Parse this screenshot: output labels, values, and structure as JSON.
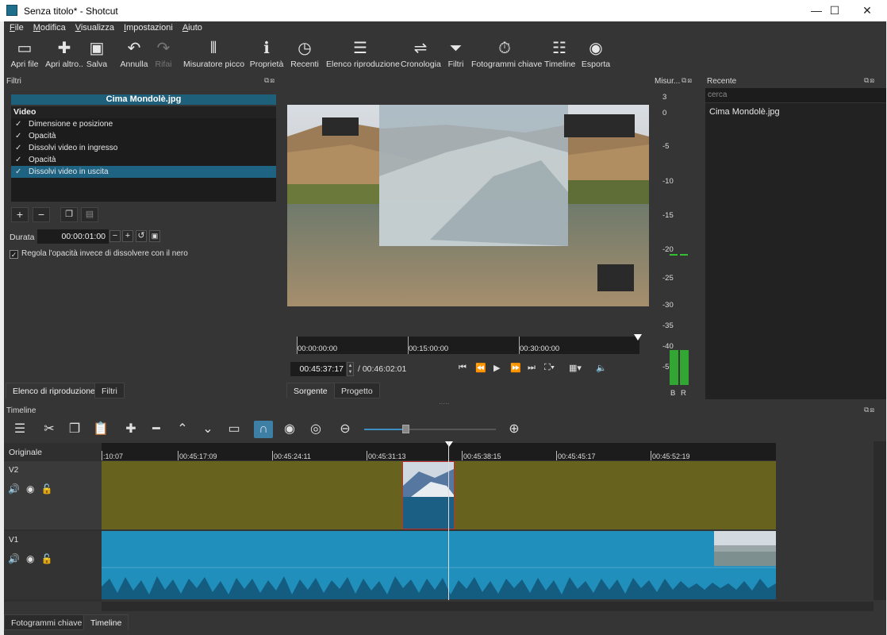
{
  "window": {
    "title": "Senza titolo* - Shotcut",
    "min": "—",
    "max": "☐",
    "close": "✕"
  },
  "menu": [
    "File",
    "Modifica",
    "Visualizza",
    "Impostazioni",
    "Aiuto"
  ],
  "toolbar": [
    {
      "label": "Apri file",
      "icon": "folder-open-icon",
      "glyph": "▭"
    },
    {
      "label": "Apri altro..",
      "icon": "open-other-icon",
      "glyph": "✚"
    },
    {
      "label": "Salva",
      "icon": "save-icon",
      "glyph": "▣"
    },
    {
      "label": "Annulla",
      "icon": "undo-icon",
      "glyph": "↶"
    },
    {
      "label": "Rifai",
      "icon": "redo-icon",
      "glyph": "↷"
    },
    {
      "label": "Misuratore picco",
      "icon": "peak-meter-icon",
      "glyph": "⦀"
    },
    {
      "label": "Proprietà",
      "icon": "info-icon",
      "glyph": "ℹ"
    },
    {
      "label": "Recenti",
      "icon": "clock-icon",
      "glyph": "◷"
    },
    {
      "label": "Elenco riproduzione",
      "icon": "list-icon",
      "glyph": "☰"
    },
    {
      "label": "Cronologia",
      "icon": "history-icon",
      "glyph": "⇌"
    },
    {
      "label": "Filtri",
      "icon": "filter-icon",
      "glyph": "⏷"
    },
    {
      "label": "Fotogrammi chiave",
      "icon": "stopwatch-icon",
      "glyph": "⏱"
    },
    {
      "label": "Timeline",
      "icon": "timeline-icon",
      "glyph": "☷"
    },
    {
      "label": "Esporta",
      "icon": "export-icon",
      "glyph": "◉"
    }
  ],
  "filters": {
    "title": "Filtri",
    "clip_name": "Cima Mondolè.jpg",
    "section": "Video",
    "items": [
      {
        "label": "Dimensione e posizione",
        "checked": "✓"
      },
      {
        "label": "Opacità",
        "checked": "✓"
      },
      {
        "label": "Dissolvi video in ingresso",
        "checked": "✓"
      },
      {
        "label": "Opacità",
        "checked": "✓"
      },
      {
        "label": "Dissolvi video in uscita",
        "checked": "✓"
      }
    ],
    "durata_label": "Durata",
    "durata_value": "00:00:01:00",
    "regola_label": "Regola l'opacità invece di dissolvere con il nero",
    "regola_checked": "✓"
  },
  "left_tabs": [
    "Elenco di riproduzione",
    "Filtri"
  ],
  "viewer": {
    "ruler": [
      "00:00:00:00",
      "00:15:00:00",
      "00:30:00:00"
    ],
    "timecode": "00:45:37:17",
    "duration": "/ 00:46:02:01",
    "tabs": [
      "Sorgente",
      "Progetto"
    ]
  },
  "meter": {
    "title": "Misur...",
    "scale": [
      "3",
      "0",
      "-5",
      "-10",
      "-15",
      "-20",
      "-25",
      "-30",
      "-35",
      "-40",
      "-50"
    ],
    "channels": [
      "B",
      "R"
    ]
  },
  "recent": {
    "title": "Recente",
    "search_placeholder": "cerca",
    "items": [
      "Cima Mondolè.jpg"
    ]
  },
  "timeline": {
    "title": "Timeline",
    "track_header": "Originale",
    "ruler": [
      ":10:07",
      "00:45:17:09",
      "00:45:24:11",
      "00:45:31:13",
      "00:45:38:15",
      "00:45:45:17",
      "00:45:52:19"
    ],
    "tracks": [
      "V2",
      "V1"
    ]
  },
  "bottom_tabs": [
    "Fotogrammi chiave",
    "Timeline"
  ],
  "colors": {
    "panel": "#353535",
    "accent": "#1e6382",
    "v2": "#67631e",
    "v1": "#218fbc"
  }
}
